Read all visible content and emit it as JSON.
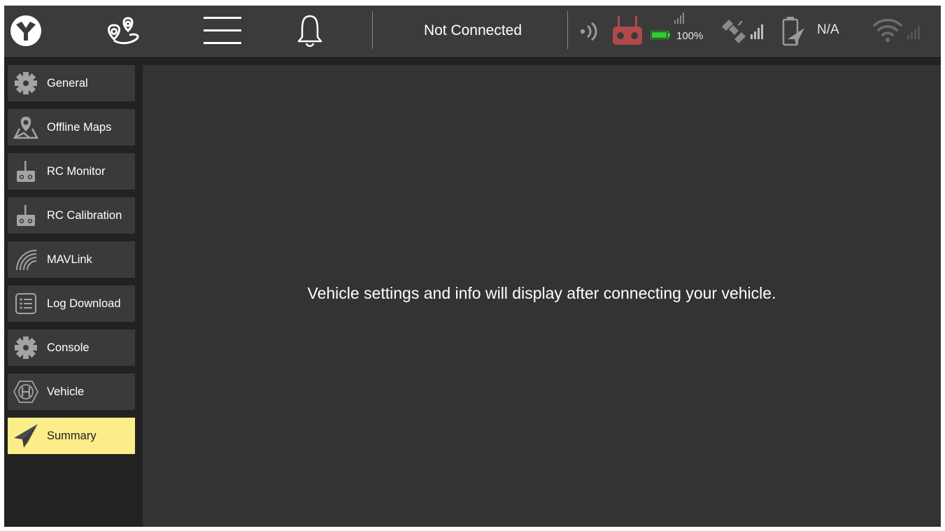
{
  "toolbar": {
    "status": "Not Connected",
    "battery_percent_label": "100%",
    "vehicle_battery_label": "N/A",
    "icons": [
      "app-logo-icon",
      "plan-view-icon",
      "menu-icon",
      "notifications-bell-icon",
      "rssi-icon",
      "rc-transmitter-icon",
      "battery-icon",
      "gps-icon",
      "vehicle-battery-icon",
      "wifi-icon"
    ],
    "colors": {
      "rc_transmitter": "#b04a4a",
      "battery_fill": "#33cc33",
      "background": "#3b3b3b"
    }
  },
  "sidebar": {
    "items": [
      {
        "label": "General",
        "icon": "gear-icon",
        "active": false
      },
      {
        "label": "Offline Maps",
        "icon": "map-pin-icon",
        "active": false
      },
      {
        "label": "RC Monitor",
        "icon": "rc-icon",
        "active": false
      },
      {
        "label": "RC Calibration",
        "icon": "rc-icon",
        "active": false
      },
      {
        "label": "MAVLink",
        "icon": "signal-icon",
        "active": false
      },
      {
        "label": "Log Download",
        "icon": "list-icon",
        "active": false
      },
      {
        "label": "Console",
        "icon": "gear-icon",
        "active": false
      },
      {
        "label": "Vehicle",
        "icon": "hexagon-h-icon",
        "active": false
      },
      {
        "label": "Summary",
        "icon": "paper-plane-icon",
        "active": true
      }
    ],
    "colors": {
      "active": "#fced8b",
      "button": "#3a3a3a"
    }
  },
  "main": {
    "message": "Vehicle settings and info will display after connecting your vehicle."
  }
}
